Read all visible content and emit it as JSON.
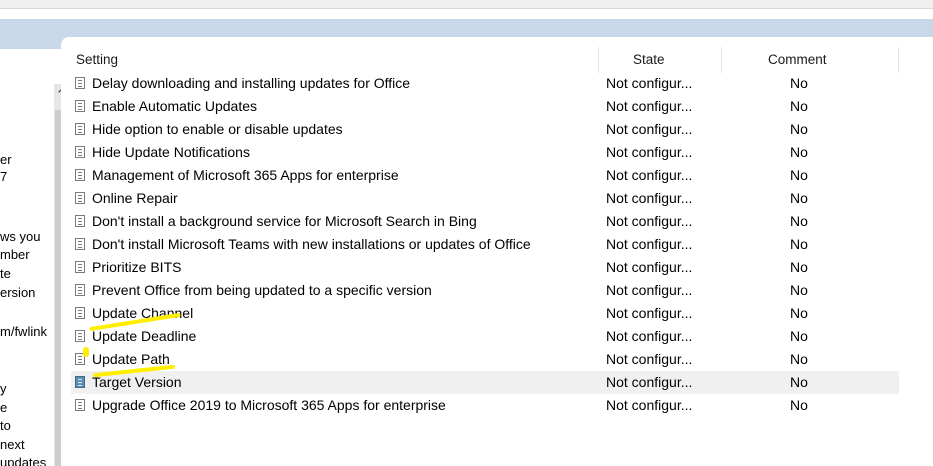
{
  "left_pane": {
    "lines": [
      "er",
      "7",
      "ws you",
      "mber",
      "te",
      "ersion",
      "m/fwlink",
      "y",
      "e",
      "to",
      "next",
      "updates"
    ]
  },
  "table": {
    "columns": {
      "setting": "Setting",
      "state": "State",
      "comment": "Comment"
    },
    "rows": [
      {
        "setting": "Delay downloading and installing updates for Office",
        "state": "Not configur...",
        "comment": "No"
      },
      {
        "setting": "Enable Automatic Updates",
        "state": "Not configur...",
        "comment": "No"
      },
      {
        "setting": "Hide option to enable or disable updates",
        "state": "Not configur...",
        "comment": "No"
      },
      {
        "setting": "Hide Update Notifications",
        "state": "Not configur...",
        "comment": "No"
      },
      {
        "setting": "Management of Microsoft 365 Apps for enterprise",
        "state": "Not configur...",
        "comment": "No"
      },
      {
        "setting": "Online Repair",
        "state": "Not configur...",
        "comment": "No"
      },
      {
        "setting": "Don't install a background service for Microsoft Search in Bing",
        "state": "Not configur...",
        "comment": "No"
      },
      {
        "setting": "Don't install Microsoft Teams with new installations or updates of Office",
        "state": "Not configur...",
        "comment": "No"
      },
      {
        "setting": "Prioritize BITS",
        "state": "Not configur...",
        "comment": "No"
      },
      {
        "setting": "Prevent Office from being updated to a specific version",
        "state": "Not configur...",
        "comment": "No"
      },
      {
        "setting": "Update Channel",
        "state": "Not configur...",
        "comment": "No"
      },
      {
        "setting": "Update Deadline",
        "state": "Not configur...",
        "comment": "No"
      },
      {
        "setting": "Update Path",
        "state": "Not configur...",
        "comment": "No"
      },
      {
        "setting": "Target Version",
        "state": "Not configur...",
        "comment": "No"
      },
      {
        "setting": "Upgrade Office 2019 to Microsoft 365 Apps for enterprise",
        "state": "Not configur...",
        "comment": "No"
      }
    ]
  },
  "icons": {
    "policy": "policy-setting-icon",
    "scroll_up": "chevron-up-icon"
  },
  "colors": {
    "highlight": "#ffee00",
    "band": "#c8d8ea",
    "selected_row": "#f0f0f0"
  }
}
